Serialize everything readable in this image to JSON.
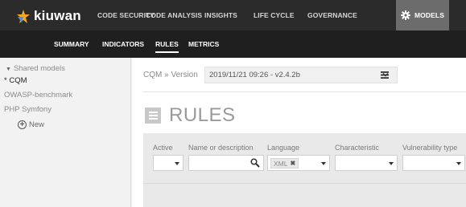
{
  "brand": {
    "name": "kiuwan",
    "accent": "#f5a623",
    "accent2": "#4a90d9"
  },
  "top_nav": [
    {
      "label": "CODE SECURITY",
      "active": false
    },
    {
      "label": "CODE ANALYSIS",
      "active": false
    },
    {
      "label": "INSIGHTS",
      "active": false
    },
    {
      "label": "LIFE CYCLE",
      "active": false
    },
    {
      "label": "GOVERNANCE",
      "active": false
    },
    {
      "label": "MODELS",
      "active": true,
      "icon": "gear-icon"
    }
  ],
  "sub_nav": [
    {
      "label": "SUMMARY",
      "active": false
    },
    {
      "label": "INDICATORS",
      "active": false
    },
    {
      "label": "RULES",
      "active": true
    },
    {
      "label": "METRICS",
      "active": false
    }
  ],
  "sidebar": {
    "group_label": "Shared models",
    "items": [
      {
        "label": "* CQM",
        "selected": true
      },
      {
        "label": "OWASP-benchmark",
        "selected": false
      },
      {
        "label": "PHP Symfony",
        "selected": false
      }
    ],
    "new_label": "New"
  },
  "main": {
    "breadcrumb": "CQM » Version",
    "version_value": "2019/11/21 09:26 - v2.4.2b",
    "page_title": "RULES"
  },
  "filters": {
    "labels": [
      "Active",
      "Name or description",
      "Language",
      "Characteristic",
      "Vulnerability type"
    ],
    "language_tag": "XML"
  },
  "colors": {
    "topbar": "#2b2b2b",
    "subbar": "#1f1f1f",
    "active_tab": "#6c6c6c"
  }
}
